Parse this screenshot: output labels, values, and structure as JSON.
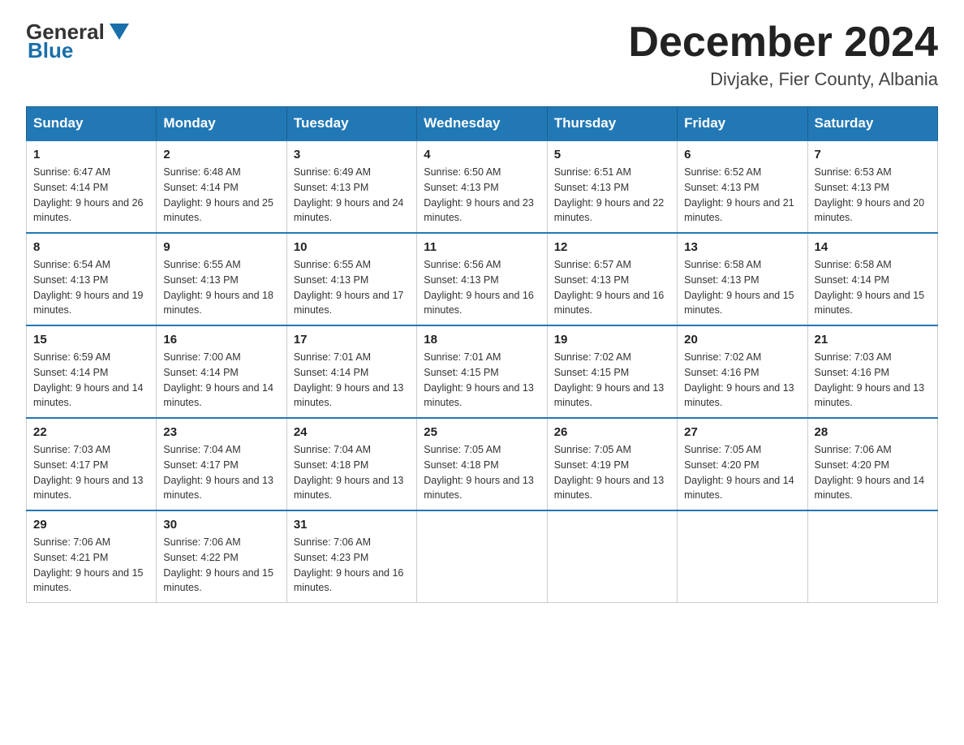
{
  "header": {
    "logo_general": "General",
    "logo_blue": "Blue",
    "month_title": "December 2024",
    "location": "Divjake, Fier County, Albania"
  },
  "days_of_week": [
    "Sunday",
    "Monday",
    "Tuesday",
    "Wednesday",
    "Thursday",
    "Friday",
    "Saturday"
  ],
  "weeks": [
    [
      {
        "day": "1",
        "sunrise": "Sunrise: 6:47 AM",
        "sunset": "Sunset: 4:14 PM",
        "daylight": "Daylight: 9 hours and 26 minutes."
      },
      {
        "day": "2",
        "sunrise": "Sunrise: 6:48 AM",
        "sunset": "Sunset: 4:14 PM",
        "daylight": "Daylight: 9 hours and 25 minutes."
      },
      {
        "day": "3",
        "sunrise": "Sunrise: 6:49 AM",
        "sunset": "Sunset: 4:13 PM",
        "daylight": "Daylight: 9 hours and 24 minutes."
      },
      {
        "day": "4",
        "sunrise": "Sunrise: 6:50 AM",
        "sunset": "Sunset: 4:13 PM",
        "daylight": "Daylight: 9 hours and 23 minutes."
      },
      {
        "day": "5",
        "sunrise": "Sunrise: 6:51 AM",
        "sunset": "Sunset: 4:13 PM",
        "daylight": "Daylight: 9 hours and 22 minutes."
      },
      {
        "day": "6",
        "sunrise": "Sunrise: 6:52 AM",
        "sunset": "Sunset: 4:13 PM",
        "daylight": "Daylight: 9 hours and 21 minutes."
      },
      {
        "day": "7",
        "sunrise": "Sunrise: 6:53 AM",
        "sunset": "Sunset: 4:13 PM",
        "daylight": "Daylight: 9 hours and 20 minutes."
      }
    ],
    [
      {
        "day": "8",
        "sunrise": "Sunrise: 6:54 AM",
        "sunset": "Sunset: 4:13 PM",
        "daylight": "Daylight: 9 hours and 19 minutes."
      },
      {
        "day": "9",
        "sunrise": "Sunrise: 6:55 AM",
        "sunset": "Sunset: 4:13 PM",
        "daylight": "Daylight: 9 hours and 18 minutes."
      },
      {
        "day": "10",
        "sunrise": "Sunrise: 6:55 AM",
        "sunset": "Sunset: 4:13 PM",
        "daylight": "Daylight: 9 hours and 17 minutes."
      },
      {
        "day": "11",
        "sunrise": "Sunrise: 6:56 AM",
        "sunset": "Sunset: 4:13 PM",
        "daylight": "Daylight: 9 hours and 16 minutes."
      },
      {
        "day": "12",
        "sunrise": "Sunrise: 6:57 AM",
        "sunset": "Sunset: 4:13 PM",
        "daylight": "Daylight: 9 hours and 16 minutes."
      },
      {
        "day": "13",
        "sunrise": "Sunrise: 6:58 AM",
        "sunset": "Sunset: 4:13 PM",
        "daylight": "Daylight: 9 hours and 15 minutes."
      },
      {
        "day": "14",
        "sunrise": "Sunrise: 6:58 AM",
        "sunset": "Sunset: 4:14 PM",
        "daylight": "Daylight: 9 hours and 15 minutes."
      }
    ],
    [
      {
        "day": "15",
        "sunrise": "Sunrise: 6:59 AM",
        "sunset": "Sunset: 4:14 PM",
        "daylight": "Daylight: 9 hours and 14 minutes."
      },
      {
        "day": "16",
        "sunrise": "Sunrise: 7:00 AM",
        "sunset": "Sunset: 4:14 PM",
        "daylight": "Daylight: 9 hours and 14 minutes."
      },
      {
        "day": "17",
        "sunrise": "Sunrise: 7:01 AM",
        "sunset": "Sunset: 4:14 PM",
        "daylight": "Daylight: 9 hours and 13 minutes."
      },
      {
        "day": "18",
        "sunrise": "Sunrise: 7:01 AM",
        "sunset": "Sunset: 4:15 PM",
        "daylight": "Daylight: 9 hours and 13 minutes."
      },
      {
        "day": "19",
        "sunrise": "Sunrise: 7:02 AM",
        "sunset": "Sunset: 4:15 PM",
        "daylight": "Daylight: 9 hours and 13 minutes."
      },
      {
        "day": "20",
        "sunrise": "Sunrise: 7:02 AM",
        "sunset": "Sunset: 4:16 PM",
        "daylight": "Daylight: 9 hours and 13 minutes."
      },
      {
        "day": "21",
        "sunrise": "Sunrise: 7:03 AM",
        "sunset": "Sunset: 4:16 PM",
        "daylight": "Daylight: 9 hours and 13 minutes."
      }
    ],
    [
      {
        "day": "22",
        "sunrise": "Sunrise: 7:03 AM",
        "sunset": "Sunset: 4:17 PM",
        "daylight": "Daylight: 9 hours and 13 minutes."
      },
      {
        "day": "23",
        "sunrise": "Sunrise: 7:04 AM",
        "sunset": "Sunset: 4:17 PM",
        "daylight": "Daylight: 9 hours and 13 minutes."
      },
      {
        "day": "24",
        "sunrise": "Sunrise: 7:04 AM",
        "sunset": "Sunset: 4:18 PM",
        "daylight": "Daylight: 9 hours and 13 minutes."
      },
      {
        "day": "25",
        "sunrise": "Sunrise: 7:05 AM",
        "sunset": "Sunset: 4:18 PM",
        "daylight": "Daylight: 9 hours and 13 minutes."
      },
      {
        "day": "26",
        "sunrise": "Sunrise: 7:05 AM",
        "sunset": "Sunset: 4:19 PM",
        "daylight": "Daylight: 9 hours and 13 minutes."
      },
      {
        "day": "27",
        "sunrise": "Sunrise: 7:05 AM",
        "sunset": "Sunset: 4:20 PM",
        "daylight": "Daylight: 9 hours and 14 minutes."
      },
      {
        "day": "28",
        "sunrise": "Sunrise: 7:06 AM",
        "sunset": "Sunset: 4:20 PM",
        "daylight": "Daylight: 9 hours and 14 minutes."
      }
    ],
    [
      {
        "day": "29",
        "sunrise": "Sunrise: 7:06 AM",
        "sunset": "Sunset: 4:21 PM",
        "daylight": "Daylight: 9 hours and 15 minutes."
      },
      {
        "day": "30",
        "sunrise": "Sunrise: 7:06 AM",
        "sunset": "Sunset: 4:22 PM",
        "daylight": "Daylight: 9 hours and 15 minutes."
      },
      {
        "day": "31",
        "sunrise": "Sunrise: 7:06 AM",
        "sunset": "Sunset: 4:23 PM",
        "daylight": "Daylight: 9 hours and 16 minutes."
      },
      null,
      null,
      null,
      null
    ]
  ]
}
